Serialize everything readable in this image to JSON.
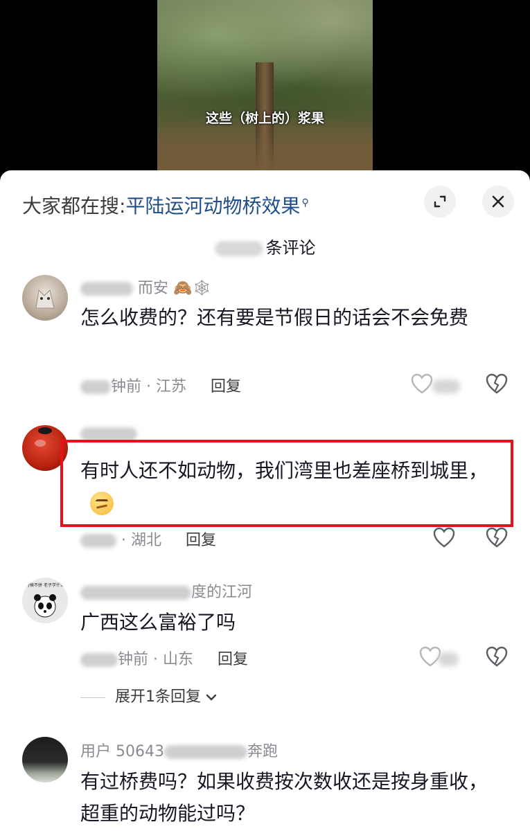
{
  "video": {
    "caption": "这些（树上的）浆果"
  },
  "sheet": {
    "search_prefix": "大家都在搜:",
    "search_term": "平陆运河动物桥效果",
    "comment_count_suffix": "条评论",
    "colors": {
      "link": "#1e4f8a",
      "highlight": "#e8101a",
      "secondary": "#8a8b91"
    }
  },
  "comments": [
    {
      "username": "而安",
      "username_emoji": "🙈🕸",
      "text": "怎么收费的？还有要是节假日的话会不会免费",
      "time": "钟前",
      "location": "· 江苏",
      "reply_label": "回复"
    },
    {
      "username": "",
      "text": "有时人还不如动物，我们湾里也差座桥到城里，",
      "location": "· 湖北",
      "reply_label": "回复"
    },
    {
      "username": "度的江河",
      "text": "广西这么富裕了吗",
      "time": "钟前",
      "location": "· 山东",
      "reply_label": "回复",
      "expand_replies_label": "展开1条回复",
      "avatar_text": "年轻的时候不拼 老子学什么哪替我"
    },
    {
      "username_prefix": "用户 50643",
      "username_suffix": "奔跑",
      "text": "有过桥费吗？如果收费按次数收还是按身重收，超重的动物能过吗？"
    }
  ]
}
